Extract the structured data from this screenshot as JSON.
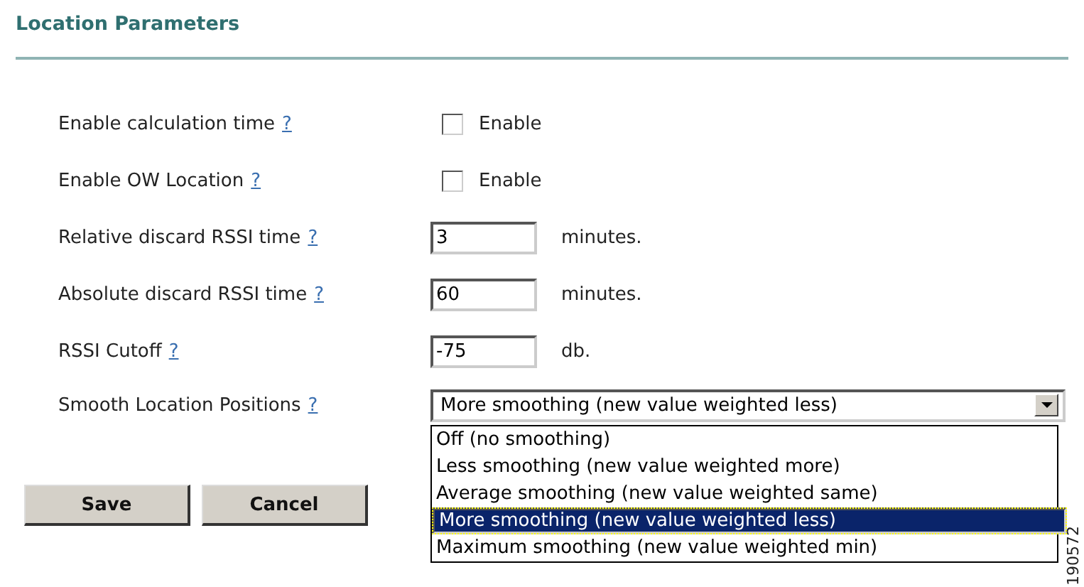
{
  "section": {
    "title": "Location Parameters"
  },
  "fields": [
    {
      "kind": "checkbox",
      "label": "Enable calculation time",
      "help": "?",
      "checked": false,
      "option": "Enable"
    },
    {
      "kind": "checkbox",
      "label": "Enable OW Location",
      "help": "?",
      "checked": false,
      "option": "Enable"
    },
    {
      "kind": "text",
      "label": "Relative discard RSSI time",
      "help": "?",
      "value": "3",
      "unit": "minutes."
    },
    {
      "kind": "text",
      "label": "Absolute discard RSSI time",
      "help": "?",
      "value": "60",
      "unit": "minutes."
    },
    {
      "kind": "text",
      "label": "RSSI Cutoff",
      "help": "?",
      "value": "-75",
      "unit": "db."
    },
    {
      "kind": "select",
      "label": "Smooth Location Positions",
      "help": "?",
      "value": "More smoothing (new value weighted less)",
      "expanded": true,
      "options": [
        {
          "label": "Off (no smoothing)",
          "selected": false
        },
        {
          "label": "Less smoothing (new value weighted more)",
          "selected": false
        },
        {
          "label": "Average smoothing (new value weighted same)",
          "selected": false
        },
        {
          "label": "More smoothing (new value weighted less)",
          "selected": true
        },
        {
          "label": "Maximum smoothing (new value weighted min)",
          "selected": false
        }
      ]
    }
  ],
  "buttons": [
    "Save",
    "Cancel"
  ],
  "figure_id": "190572"
}
